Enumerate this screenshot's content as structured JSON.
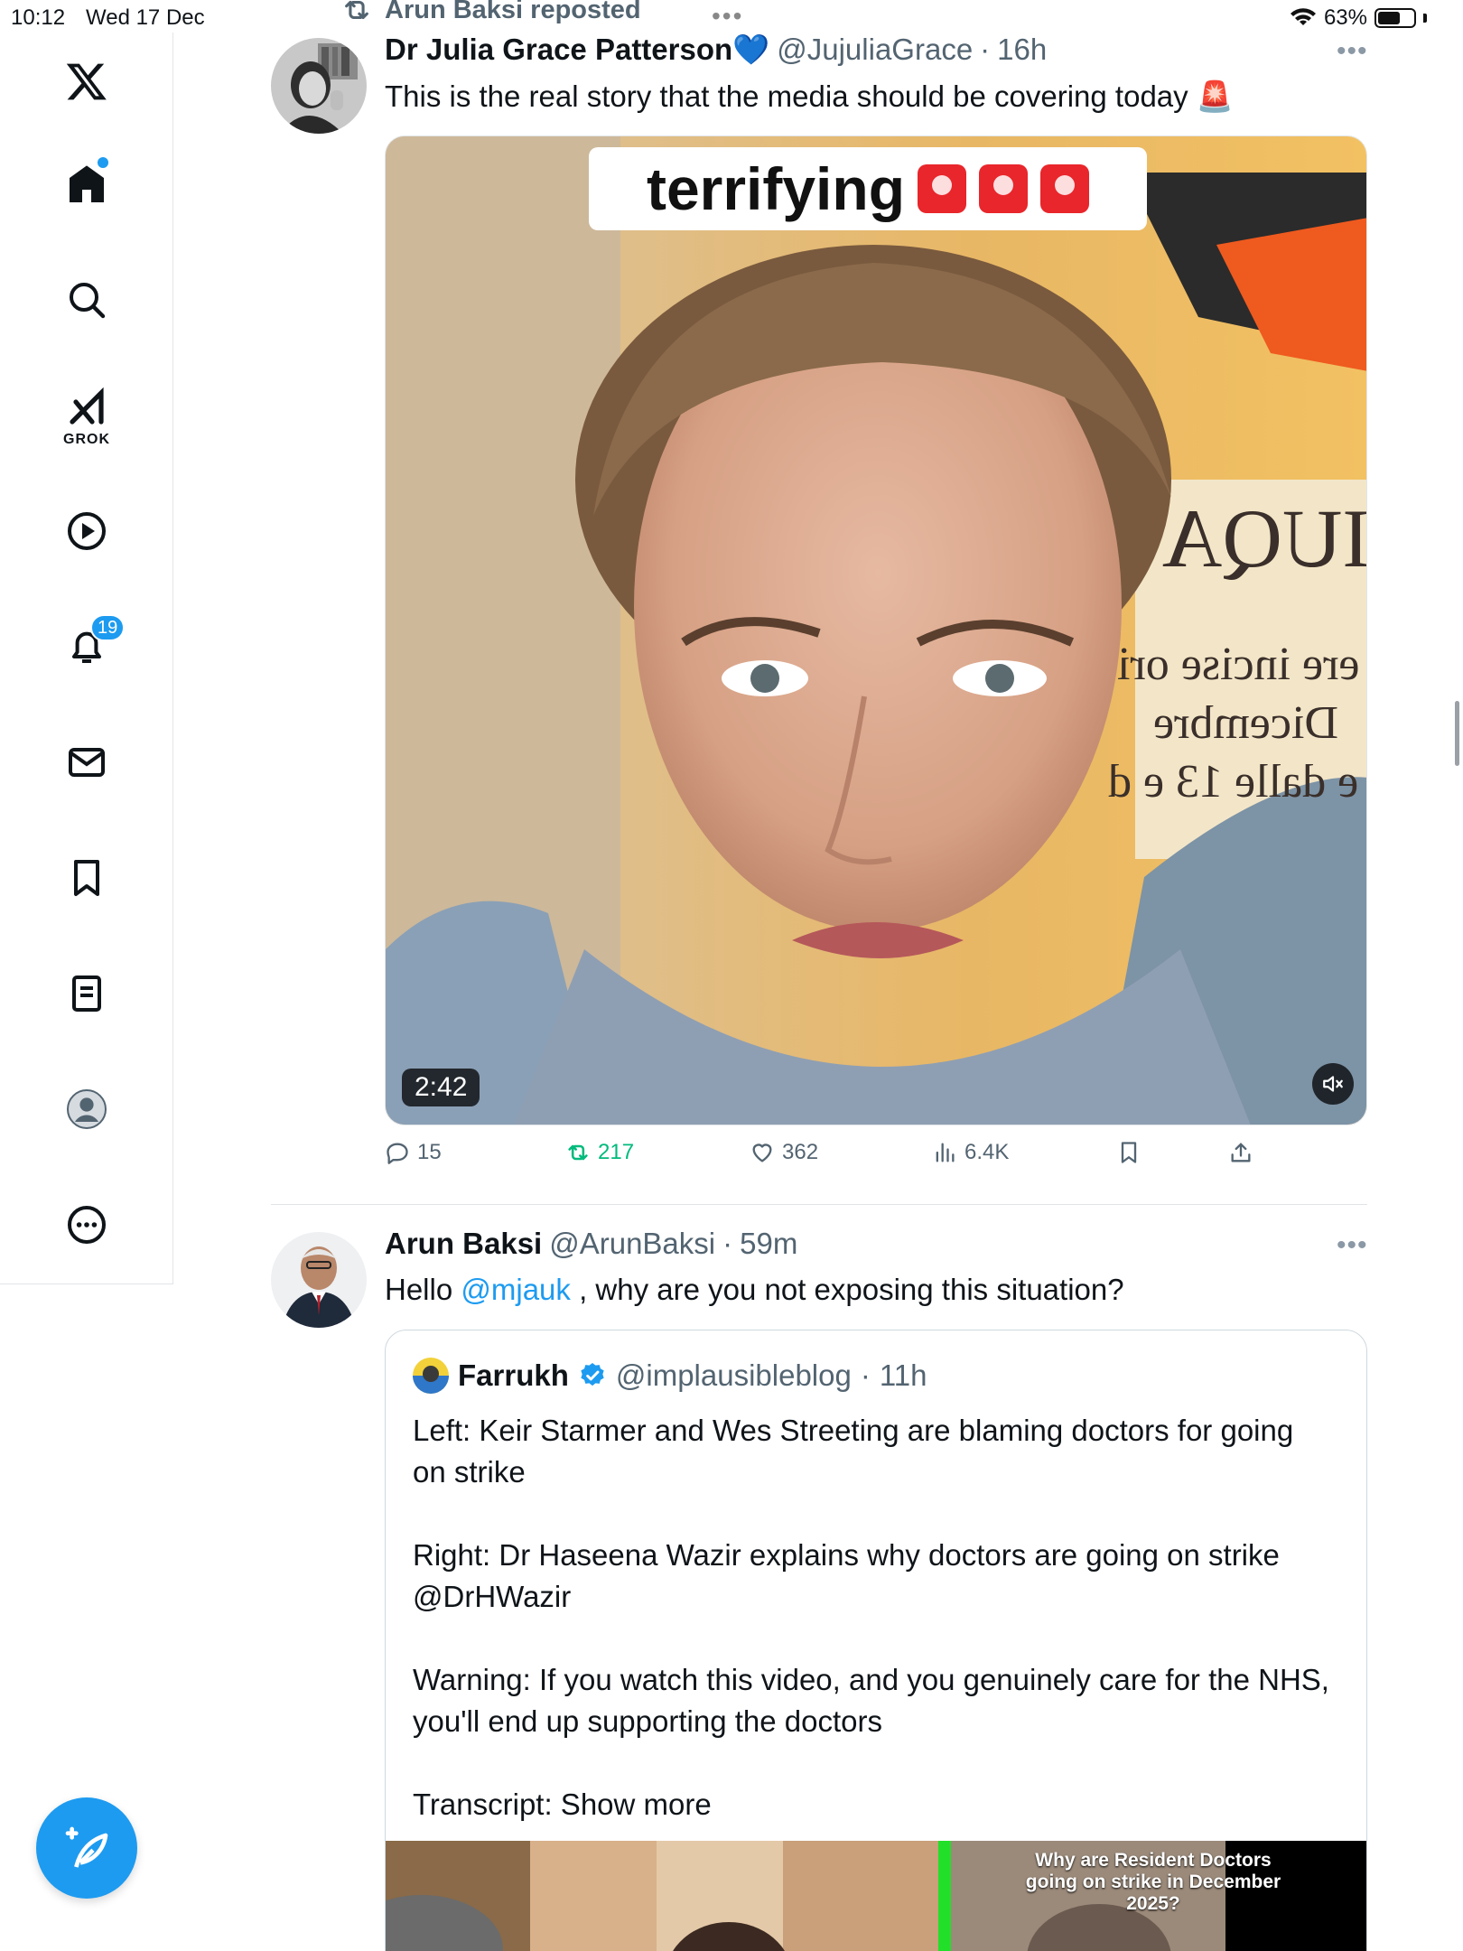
{
  "status_bar": {
    "time": "10:12",
    "date": "Wed 17 Dec",
    "battery": "63%",
    "battery_level": 0.63
  },
  "sidebar": {
    "logo": "x-logo-icon",
    "items": [
      {
        "name": "home",
        "icon": "home-icon",
        "indicator": true
      },
      {
        "name": "search",
        "icon": "search-icon"
      },
      {
        "name": "grok",
        "icon": "grok-icon",
        "label": "GROK"
      },
      {
        "name": "video",
        "icon": "play-icon"
      },
      {
        "name": "notifications",
        "icon": "bell-icon",
        "badge": "19"
      },
      {
        "name": "messages",
        "icon": "mail-icon"
      },
      {
        "name": "bookmarks",
        "icon": "bookmark-icon"
      },
      {
        "name": "articles",
        "icon": "article-icon"
      },
      {
        "name": "profile",
        "icon": "profile-icon"
      },
      {
        "name": "more",
        "icon": "more-circle-icon"
      }
    ],
    "compose_icon": "compose-icon"
  },
  "feed": {
    "repost_label": "Arun Baksi reposted",
    "tweet1": {
      "name": "Dr Julia Grace Patterson",
      "name_emoji": "💙",
      "handle": "@JujuliaGrace",
      "time": "16h",
      "text": "This is the real story that the media should be covering today 🚨",
      "video": {
        "caption": "terrifying",
        "duration": "2:42",
        "poster_lines": [
          "IUQA",
          "ere incise ori",
          "Dicembre",
          "e dalle 13 e d"
        ]
      },
      "stats": {
        "replies": "15",
        "reposts": "217",
        "likes": "362",
        "views": "6.4K"
      }
    },
    "tweet2": {
      "name": "Arun Baksi",
      "handle": "@ArunBaksi",
      "time": "59m",
      "text_before": "Hello ",
      "mention": "@mjauk",
      "text_after": " , why are you not exposing this situation?",
      "quote": {
        "name": "Farrukh",
        "handle": "@implausibleblog",
        "time": "11h",
        "paragraphs": [
          "Left: Keir Starmer and Wes Streeting are blaming doctors for going on strike",
          "Right: Dr Haseena Wazir explains why doctors are going on strike @DrHWazir",
          "Warning: If you watch this video, and you genuinely care for the NHS, you'll end up supporting the doctors",
          "Transcript: Show more"
        ],
        "media_title": "Why are Resident Doctors going on strike in December 2025?"
      }
    }
  },
  "colors": {
    "accent": "#1d9bf0",
    "repost_green": "#00ba7c",
    "muted": "#536471",
    "alert_red": "#e8262b"
  }
}
